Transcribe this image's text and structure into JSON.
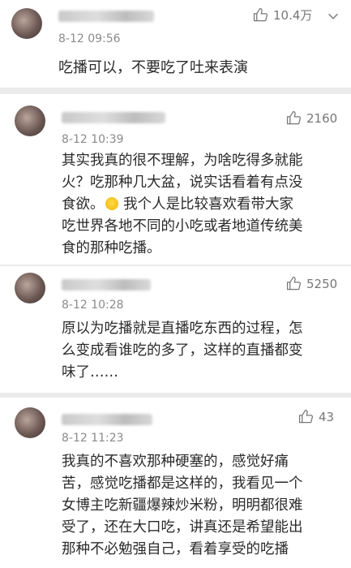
{
  "comments": [
    {
      "time": "8-12 09:56",
      "likes": "10.4万",
      "text": "吃播可以，不要吃了吐来表演"
    },
    {
      "time": "8-12 10:39",
      "likes": "2160",
      "text_before_emoji": "其实我真的很不理解，为啥吃得多就能\n火？吃那种几大盆，说实话看着有点没\n食欲。",
      "text_after_emoji": " 我个人是比较喜欢看带大家\n吃世界各地不同的小吃或者地道传统美\n食的那种吃播。"
    },
    {
      "time": "8-12 10:28",
      "likes": "5250",
      "text": "原以为吃播就是直播吃东西的过程，怎\n么变成看谁吃的多了，这样的直播都变\n味了……"
    },
    {
      "time": "8-12 11:23",
      "likes": "43",
      "text": "我真的不喜欢那种硬塞的，感觉好痛\n苦，感觉吃播都是这样的，我看见一个\n女博主吃新疆爆辣炒米粉，明明都很难\n受了，还在大口吃，讲真还是希望能出\n那种不必勉强自己，看着享受的吃播"
    }
  ],
  "icons": {
    "like": "thumbs-up-icon",
    "more": "chevron-down-icon"
  },
  "colors": {
    "text": "#2a2a2a",
    "meta": "#8a8a8a",
    "background": "#ebebeb"
  }
}
